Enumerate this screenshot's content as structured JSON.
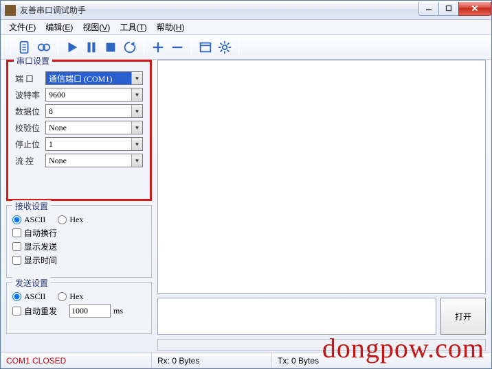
{
  "window": {
    "title": "友善串口调试助手"
  },
  "menus": {
    "file": {
      "label": "文件",
      "key": "F"
    },
    "edit": {
      "label": "编辑",
      "key": "E"
    },
    "view": {
      "label": "视图",
      "key": "V"
    },
    "tools": {
      "label": "工具",
      "key": "T"
    },
    "help": {
      "label": "帮助",
      "key": "H"
    }
  },
  "toolbar_icons": {
    "new": "new-doc",
    "record": "record",
    "play": "play",
    "pause": "pause",
    "stop": "stop",
    "reload": "reload",
    "plus": "plus",
    "minus": "minus",
    "window": "window",
    "settings": "gear"
  },
  "serial": {
    "legend": "串口设置",
    "port": {
      "label": "端 口",
      "value": "通信端口 (COM1)"
    },
    "baud": {
      "label": "波特率",
      "value": "9600"
    },
    "databits": {
      "label": "数据位",
      "value": "8"
    },
    "parity": {
      "label": "校验位",
      "value": "None"
    },
    "stopbits": {
      "label": "停止位",
      "value": "1"
    },
    "flow": {
      "label": "流 控",
      "value": "None"
    }
  },
  "receive": {
    "legend": "接收设置",
    "fmt_ascii": "ASCII",
    "fmt_hex": "Hex",
    "auto_wrap": "自动换行",
    "show_send": "显示发送",
    "show_time": "显示时间"
  },
  "send": {
    "legend": "发送设置",
    "fmt_ascii": "ASCII",
    "fmt_hex": "Hex",
    "auto_resend": "自动重发",
    "interval": "1000",
    "unit": "ms"
  },
  "buttons": {
    "open": "打开"
  },
  "status": {
    "port": "COM1 CLOSED",
    "rx": "Rx: 0 Bytes",
    "tx": "Tx: 0 Bytes"
  },
  "watermark": "dongpow.com"
}
